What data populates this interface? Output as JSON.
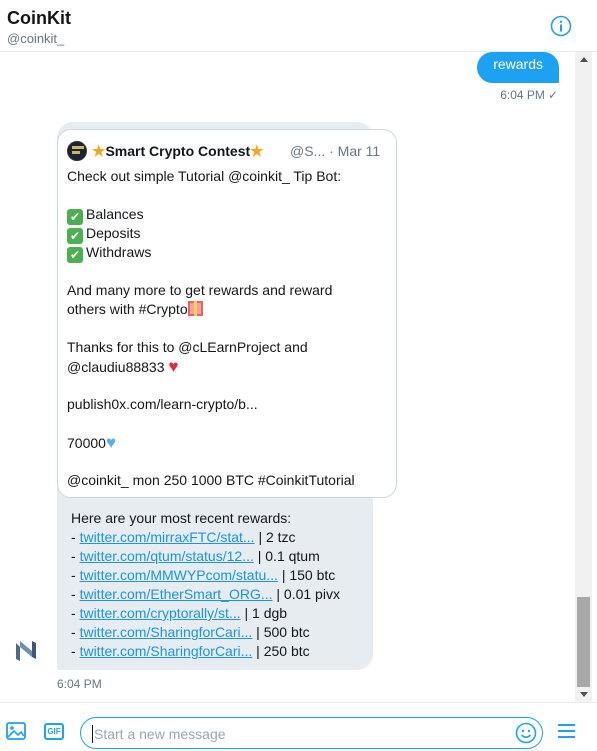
{
  "header": {
    "title": "CoinKit",
    "handle": "@coinkit_"
  },
  "sent_message": {
    "text": "rewards",
    "time": "6:04 PM",
    "status_icon": "check-icon"
  },
  "tweet": {
    "name": "Smart Crypto Contest",
    "handle_date": "@S... · Mar 11",
    "lines": {
      "intro": "Check out simple Tutorial @coinkit_ Tip Bot:",
      "item1": "Balances",
      "item2": "Deposits",
      "item3": "Withdraws",
      "more1": "And many more to get rewards and reward",
      "more2": "others with #Crypto",
      "thanks1": "Thanks for this to @cLEarnProject and",
      "thanks2": "@claudiu88833",
      "link": "publish0x.com/learn-crypto/b...",
      "number": "70000",
      "command": "@coinkit_ mon 250 1000 BTC #CoinkitTutorial"
    }
  },
  "rewards": {
    "heading": "Here are your most recent rewards:",
    "items": [
      {
        "link": "twitter.com/mirraxFTC/stat...",
        "amount": " | 2 tzc"
      },
      {
        "link": "twitter.com/qtum/status/12...",
        "amount": " | 0.1 qtum"
      },
      {
        "link": "twitter.com/MMWYPcom/statu...",
        "amount": " | 150 btc"
      },
      {
        "link": "twitter.com/EtherSmart_ORG...",
        "amount": " | 0.01 pivx"
      },
      {
        "link": "twitter.com/cryptorally/st...",
        "amount": " | 1 dgb"
      },
      {
        "link": "twitter.com/SharingforCari...",
        "amount": " | 500 btc"
      },
      {
        "link": "twitter.com/SharingforCari...",
        "amount": " | 250 btc"
      }
    ],
    "time": "6:04 PM"
  },
  "composer": {
    "placeholder": "Start a new message",
    "gif_label": "GIF"
  },
  "colors": {
    "accent": "#1da1f2",
    "bubble_received": "#e6ecf0",
    "link": "#1b95e0"
  }
}
